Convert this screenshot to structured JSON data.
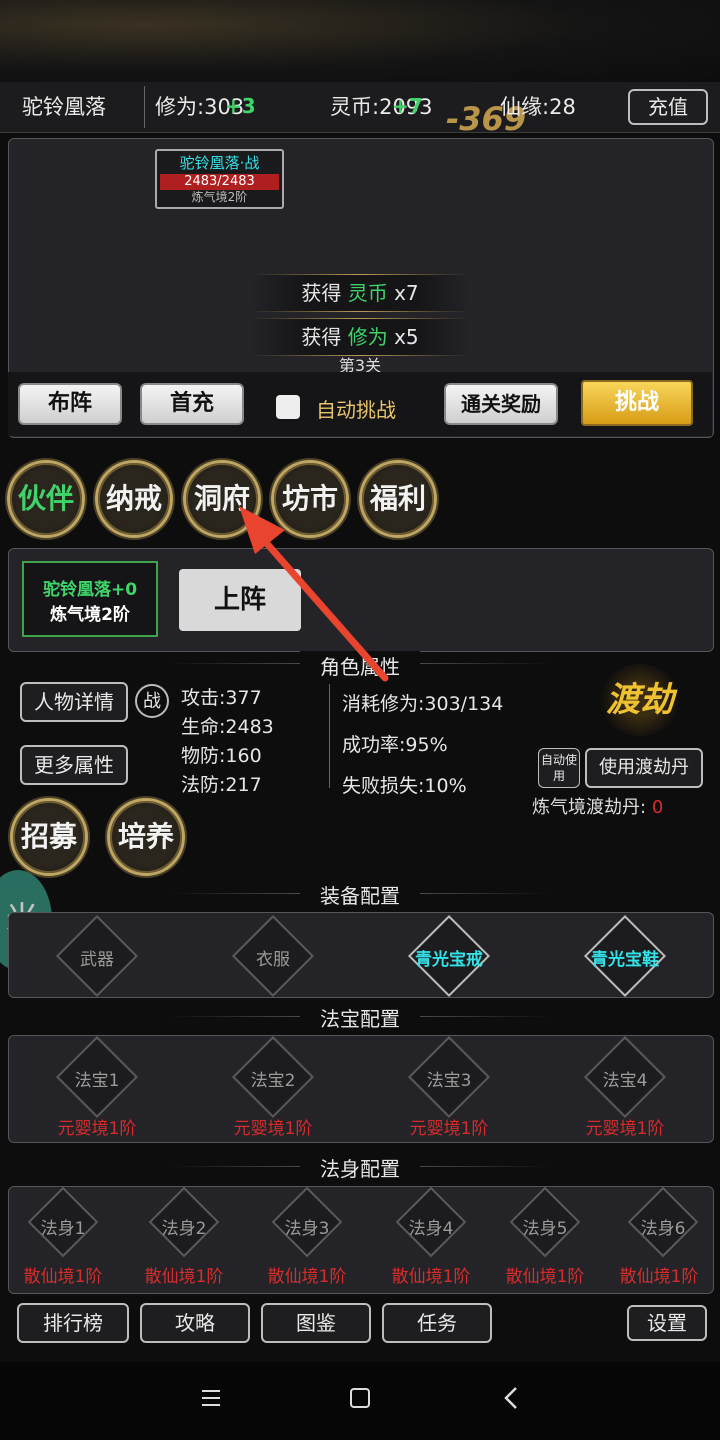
{
  "header": {
    "player_name": "驼铃凰落",
    "cultivation_label": "修为:",
    "cultivation_value": "303",
    "cultivation_gain": "+3",
    "coin_label": "灵币:",
    "coin_value": "2093",
    "coin_gain": "+7",
    "damage_popup": "-369",
    "fate_label": "仙缘:",
    "fate_value": "28",
    "recharge_label": "充值"
  },
  "battle": {
    "enemy_name": "驼铃凰落·战",
    "enemy_hp": "2483/2483",
    "enemy_realm": "炼气境2阶",
    "rewards": [
      {
        "prefix": "获得",
        "item": "灵币",
        "count": "x7",
        "color": "#3fd36a"
      },
      {
        "prefix": "获得",
        "item": "修为",
        "count": "x5",
        "color": "#3fd36a"
      }
    ],
    "stage": "第3关",
    "hp_fraction": 1.0
  },
  "actions": {
    "formation": "布阵",
    "first_recharge": "首充",
    "auto_battle": "自动挑战",
    "auto_battle_checked": false,
    "clear_reward": "通关奖励",
    "challenge": "挑战"
  },
  "menu": [
    "伙伴",
    "纳戒",
    "洞府",
    "坊市",
    "福利"
  ],
  "partner": {
    "name": "驼铃凰落+0",
    "realm": "炼气境2阶",
    "deploy": "上阵"
  },
  "attributes": {
    "section_title": "角色属性",
    "detail_button": "人物详情",
    "battle_badge": "战",
    "more_button": "更多属性",
    "attack": "攻击:377",
    "hp": "生命:2483",
    "pdef": "物防:160",
    "mdef": "法防:217",
    "cost": "消耗修为:303/134",
    "success": "成功率:95%",
    "fail_loss": "失败损失:10%",
    "tribulation_logo": "渡劫",
    "auto_use": "自动使用",
    "use_pill": "使用渡劫丹",
    "pill_label": "炼气境渡劫丹:",
    "pill_count": "0"
  },
  "side_buttons": {
    "recruit": "招募",
    "train": "培养"
  },
  "equipment": {
    "section_title": "装备配置",
    "slots": [
      {
        "label": "武器",
        "active": false
      },
      {
        "label": "衣服",
        "active": false
      },
      {
        "label": "青光宝戒",
        "active": true
      },
      {
        "label": "青光宝鞋",
        "active": true
      }
    ]
  },
  "treasure": {
    "section_title": "法宝配置",
    "slots": [
      {
        "label": "法宝1",
        "req": "元婴境1阶"
      },
      {
        "label": "法宝2",
        "req": "元婴境1阶"
      },
      {
        "label": "法宝3",
        "req": "元婴境1阶"
      },
      {
        "label": "法宝4",
        "req": "元婴境1阶"
      }
    ]
  },
  "body": {
    "section_title": "法身配置",
    "slots": [
      {
        "label": "法身1",
        "req": "散仙境1阶"
      },
      {
        "label": "法身2",
        "req": "散仙境1阶"
      },
      {
        "label": "法身3",
        "req": "散仙境1阶"
      },
      {
        "label": "法身4",
        "req": "散仙境1阶"
      },
      {
        "label": "法身5",
        "req": "散仙境1阶"
      },
      {
        "label": "法身6",
        "req": "散仙境1阶"
      }
    ]
  },
  "bottom": [
    "排行榜",
    "攻略",
    "图鉴",
    "任务",
    "设置"
  ],
  "floating_badge": "米",
  "colors": {
    "gold": "#f2b82a",
    "green": "#3fd36a",
    "cyan": "#34e1e6",
    "red": "#d62c2c",
    "accent_arrow": "#e8442e"
  }
}
